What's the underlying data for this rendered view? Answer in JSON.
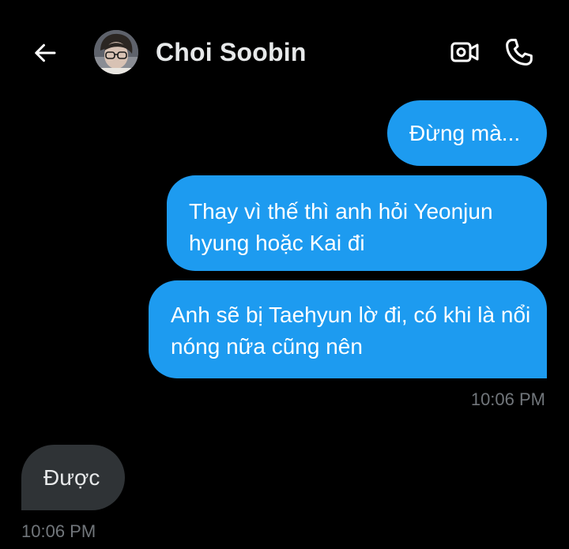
{
  "header": {
    "contact_name": "Choi Soobin",
    "back_icon": "arrow-left-icon",
    "video_icon": "video-camera-icon",
    "call_icon": "phone-icon"
  },
  "colors": {
    "background": "#000000",
    "outgoing_bubble": "#1d9bf0",
    "incoming_bubble": "#2f3336",
    "timestamp": "#71767b",
    "text": "#e7e9ea"
  },
  "messages": [
    {
      "direction": "outgoing",
      "text": "Đừng mà..."
    },
    {
      "direction": "outgoing",
      "text": "Thay vì thế thì anh hỏi Yeonjun hyung hoặc Kai đi"
    },
    {
      "direction": "outgoing",
      "text": "Anh sẽ bị Taehyun lờ đi, có khi là nổi nóng nữa cũng nên"
    },
    {
      "direction": "incoming",
      "text": "Được"
    }
  ],
  "timestamps": {
    "outgoing_group": "10:06 PM",
    "incoming_group": "10:06 PM"
  }
}
